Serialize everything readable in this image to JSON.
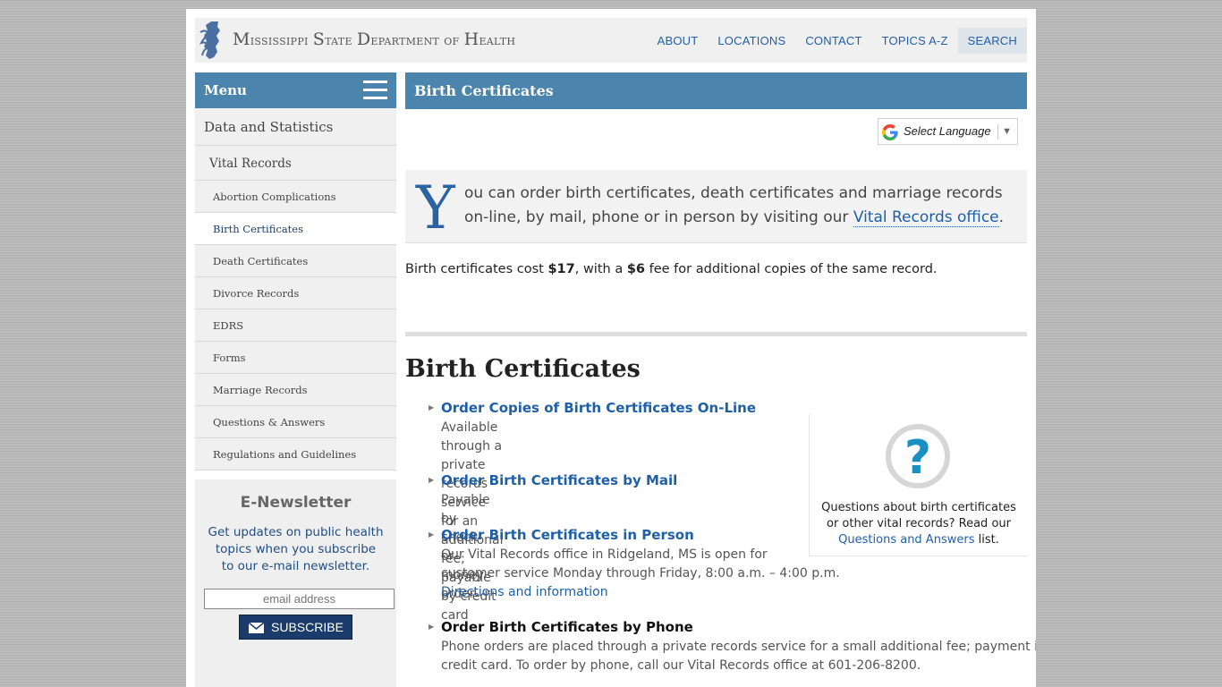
{
  "header": {
    "site_title_prefix_1": "M",
    "site_title_word_1": "ississippi",
    "site_title_prefix_2": "S",
    "site_title_word_2": "tate",
    "site_title_prefix_3": "D",
    "site_title_word_3": "epartment of",
    "site_title_prefix_4": "H",
    "site_title_word_4": "ealth",
    "nav": {
      "about": "ABOUT",
      "locations": "LOCATIONS",
      "contact": "CONTACT",
      "topics": "TOPICS A-Z",
      "search": "SEARCH"
    }
  },
  "sidebar": {
    "menu_label": "Menu",
    "items": [
      {
        "label": "Data and Statistics"
      },
      {
        "label": "Vital Records"
      },
      {
        "label": "Abortion Complications"
      },
      {
        "label": "Birth Certificates"
      },
      {
        "label": "Death Certificates"
      },
      {
        "label": "Divorce Records"
      },
      {
        "label": "EDRS"
      },
      {
        "label": "Forms"
      },
      {
        "label": "Marriage Records"
      },
      {
        "label": "Questions & Answers"
      },
      {
        "label": "Regulations and Guidelines"
      }
    ],
    "newsletter": {
      "title": "E-Newsletter",
      "text": "Get updates on public health topics when you subscribe to our e-mail newsletter.",
      "email_placeholder": "email address",
      "subscribe_label": "SUBSCRIBE"
    }
  },
  "main": {
    "page_title": "Birth Certificates",
    "language_select": "Select Language",
    "language_arrow": "▼",
    "intro": {
      "dropcap": "Y",
      "text_before": "ou can order birth certificates, death certificates and marriage records on-line, by mail, phone or in person by visiting our ",
      "link": "Vital Records office",
      "text_after": "."
    },
    "cost": {
      "t1": "Birth certificates cost ",
      "price": "$17",
      "t2": ", with a ",
      "fee": "$6",
      "t3": " fee for additional copies of the same record."
    },
    "section_heading": "Birth Certificates",
    "bullet": "▶",
    "options": [
      {
        "title": "Order Copies of Birth Certificates On-Line",
        "desc": "Available through a private records service for an additional",
        "desc2": "fee; payable by credit card"
      },
      {
        "title": "Order Birth Certificates by Mail",
        "desc": "Payable by check or money order"
      },
      {
        "title": "Order Birth Certificates in Person",
        "desc": "Our Vital Records office in Ridgeland, MS is open for",
        "desc2": "customer service Monday through Friday, 8:00 a.m. – 4:00 p.m.",
        "link": "Directions and information"
      },
      {
        "title": "Order Birth Certificates by Phone",
        "desc": "Phone orders are placed through a private records service for a small additional fee; payment is by",
        "desc2": "credit card. To order by phone, call our Vital Records office at 601-206-8200."
      }
    ],
    "qa": {
      "text": "Questions about birth certificates or other vital records? Read our",
      "link": "Questions and Answers",
      "after": " list."
    }
  }
}
